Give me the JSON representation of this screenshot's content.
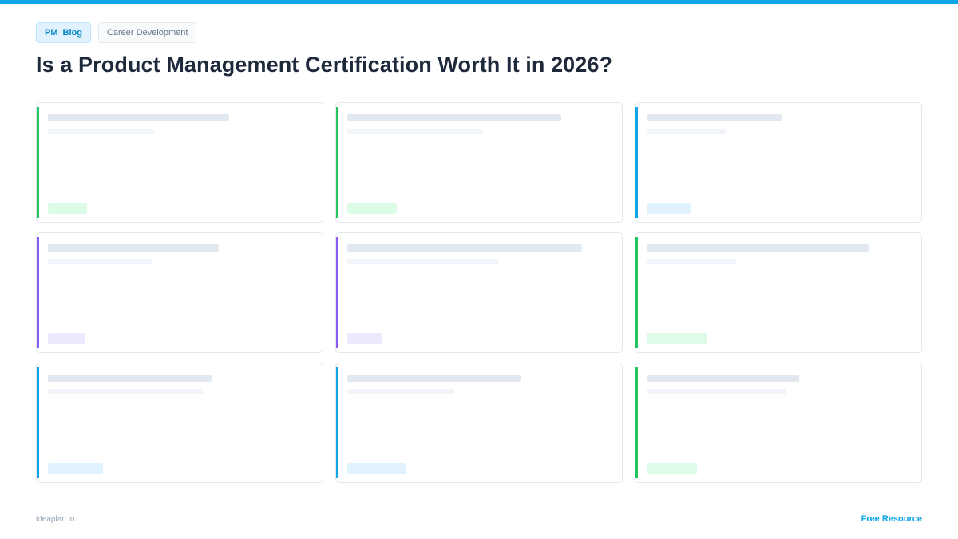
{
  "header": {
    "brand_tag": [
      "PM",
      "Blog"
    ],
    "category_tag": "Career Development",
    "title": "Is a Product Management Certification Worth It in 2026?"
  },
  "colors": {
    "top_bar": "#0ea5e9",
    "green": "#22c55e",
    "blue": "#0ea5e9",
    "purple": "#8b5cf6"
  },
  "cards": [
    {
      "accent": "green"
    },
    {
      "accent": "green"
    },
    {
      "accent": "blue"
    },
    {
      "accent": "purple"
    },
    {
      "accent": "purple"
    },
    {
      "accent": "green"
    },
    {
      "accent": "blue"
    },
    {
      "accent": "blue"
    },
    {
      "accent": "green"
    }
  ],
  "footer": {
    "site": "ideaplan.io",
    "label": "Free Resource"
  }
}
